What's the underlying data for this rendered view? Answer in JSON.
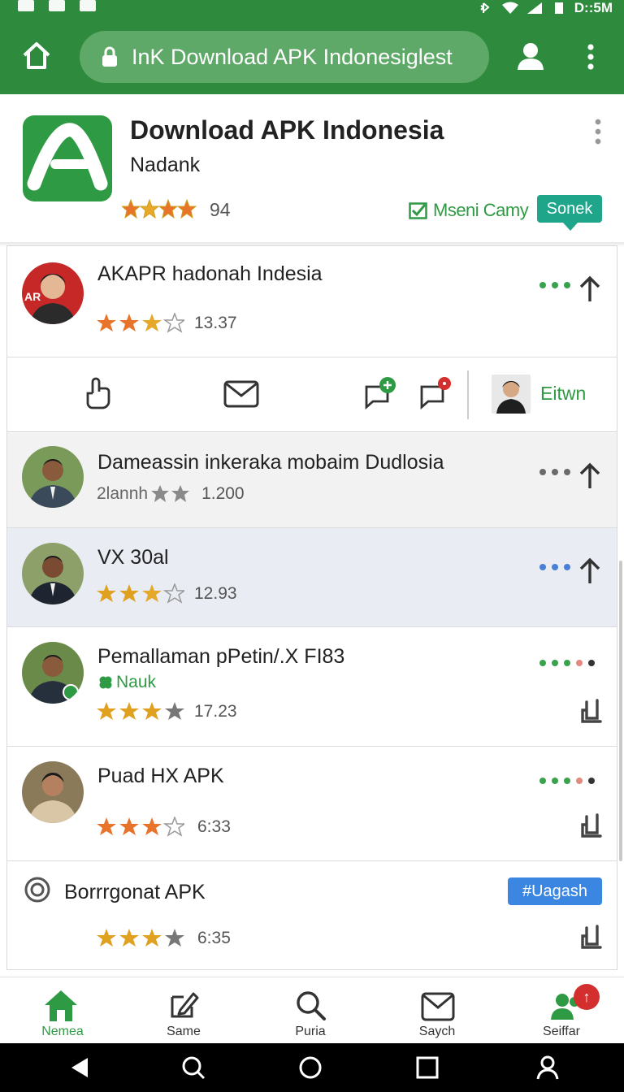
{
  "status_bar": {
    "time": "D::5M"
  },
  "app_bar": {
    "url": "InK Download APK Indonesiglest",
    "icons": [
      "home-icon",
      "lock-icon",
      "profile-icon",
      "more-vert-icon"
    ]
  },
  "header": {
    "title": "Download APK Indonesia",
    "developer": "Nadank",
    "rating": "94",
    "verified_label": "Mseni Camy",
    "badge_label": "Sonek",
    "colors": {
      "brand": "#2e8b3e",
      "accent": "#1fa58a"
    }
  },
  "items": [
    {
      "title": "AKAPR hadonah Indesia",
      "rating": "13.37",
      "stars": 2.5
    },
    {
      "title": "Damеassin inkeraka mobaim Dudlosia",
      "subtitle": "2lannh",
      "rating": "1.200",
      "stars": 2
    },
    {
      "title": "VX 30al",
      "rating": "12.93",
      "stars": 2.5
    },
    {
      "title": "Pemallaman pPetin/.X FI83",
      "tag": "Nauk",
      "rating": "17.23",
      "stars": 3.5
    },
    {
      "title": "Puad HX APK",
      "rating": "6:33",
      "stars": 3
    },
    {
      "title": "Borrrgonat APK",
      "badge": "#Uagash",
      "rating": "6:35",
      "stars": 4
    }
  ],
  "action_row": {
    "user_label": "Eitwn",
    "icons": [
      "hand-icon",
      "mail-icon",
      "chat-add-icon",
      "chat-alert-icon"
    ]
  },
  "bottom_nav": [
    {
      "label": "Nemea",
      "icon": "home-icon",
      "active": true
    },
    {
      "label": "Same",
      "icon": "edit-icon"
    },
    {
      "label": "Puria",
      "icon": "search-icon"
    },
    {
      "label": "Saych",
      "icon": "mail-icon"
    },
    {
      "label": "Seiffar",
      "icon": "people-icon",
      "badge": "↑"
    }
  ]
}
